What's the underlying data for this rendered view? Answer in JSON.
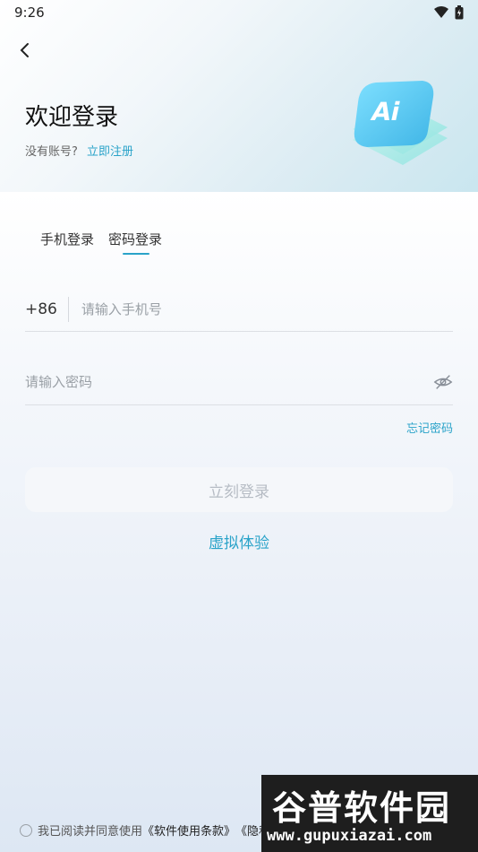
{
  "status_bar": {
    "time": "9:26"
  },
  "header": {
    "title": "欢迎登录",
    "no_account_text": "没有账号?",
    "register_link": "立即注册",
    "logo_text": "Ai"
  },
  "tabs": [
    {
      "label": "手机登录",
      "active": false
    },
    {
      "label": "密码登录",
      "active": true
    }
  ],
  "form": {
    "country_code": "+86",
    "phone_placeholder": "请输入手机号",
    "password_placeholder": "请输入密码",
    "forgot_label": "忘记密码",
    "login_button": "立刻登录",
    "virtual_link": "虚拟体验"
  },
  "agreement": {
    "prefix": "我已阅读并同意使用",
    "software_terms": "《软件使用条款》",
    "privacy_terms": "《隐私条款》"
  },
  "watermark": {
    "title": "谷普软件园",
    "url": "www.gupuxiazai.com"
  },
  "colors": {
    "accent": "#2aa3c9",
    "disabled_text": "#b6bcc4"
  },
  "icons": [
    "back-arrow-icon",
    "wifi-icon",
    "battery-icon",
    "eye-hidden-icon",
    "ai-logo-icon"
  ]
}
